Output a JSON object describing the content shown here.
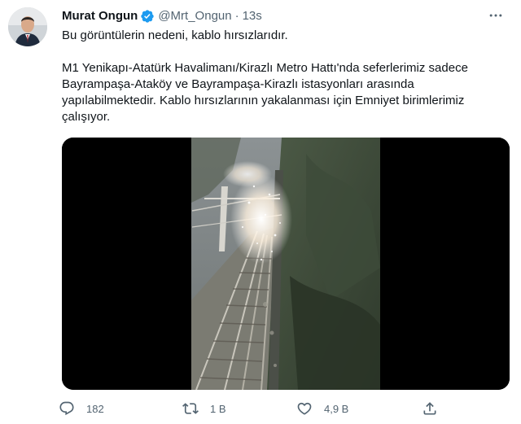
{
  "author": {
    "display_name": "Murat Ongun",
    "handle": "@Mrt_Ongun",
    "separator": "·",
    "timestamp": "13s",
    "verified_icon": "verified-badge-icon",
    "avatar_icon": "avatar"
  },
  "tweet": {
    "line1": "Bu görüntülerin nedeni, kablo hırsızlarıdır.",
    "line2": "M1 Yenikapı-Atatürk Havalimanı/Kirazlı Metro Hattı'nda seferlerimiz sadece Bayrampaşa-Ataköy ve Bayrampaşa-Kirazlı istasyonları arasında yapılabilmektedir. Kablo hırsızlarının yakalanması için Emniyet birimlerimiz çalışıyor."
  },
  "media": {
    "type": "video",
    "description_icon": "video-thumbnail"
  },
  "actions": {
    "reply": {
      "icon": "reply-icon",
      "count": "182"
    },
    "retweet": {
      "icon": "retweet-icon",
      "count": "1 B"
    },
    "like": {
      "icon": "heart-icon",
      "count": "4,9 B"
    },
    "share": {
      "icon": "share-icon"
    }
  },
  "more_icon": "more-options-icon",
  "colors": {
    "verified": "#1d9bf0",
    "secondary_text": "#536471",
    "primary_text": "#0f1419"
  }
}
